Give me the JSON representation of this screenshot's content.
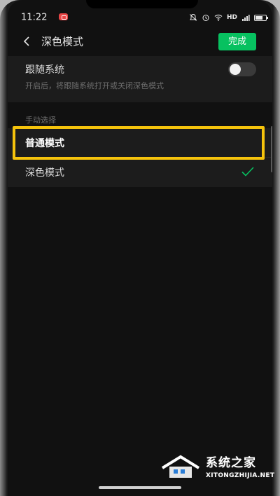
{
  "status_bar": {
    "time": "11:22",
    "network": "HD"
  },
  "nav": {
    "title": "深色模式",
    "done_label": "完成",
    "accent_color": "#07c160"
  },
  "follow_system": {
    "title": "跟随系统",
    "description": "开启后，将跟随系统打开或关闭深色模式",
    "enabled": false
  },
  "manual": {
    "section_label": "手动选择",
    "options": [
      {
        "label": "普通模式",
        "selected": false,
        "highlighted": true
      },
      {
        "label": "深色模式",
        "selected": true,
        "highlighted": false
      }
    ]
  },
  "watermark": {
    "name": "系统之家",
    "domain": "XITONGZHIJIA.NET"
  },
  "colors": {
    "highlight": "#f5c30c",
    "check": "#07c160"
  }
}
